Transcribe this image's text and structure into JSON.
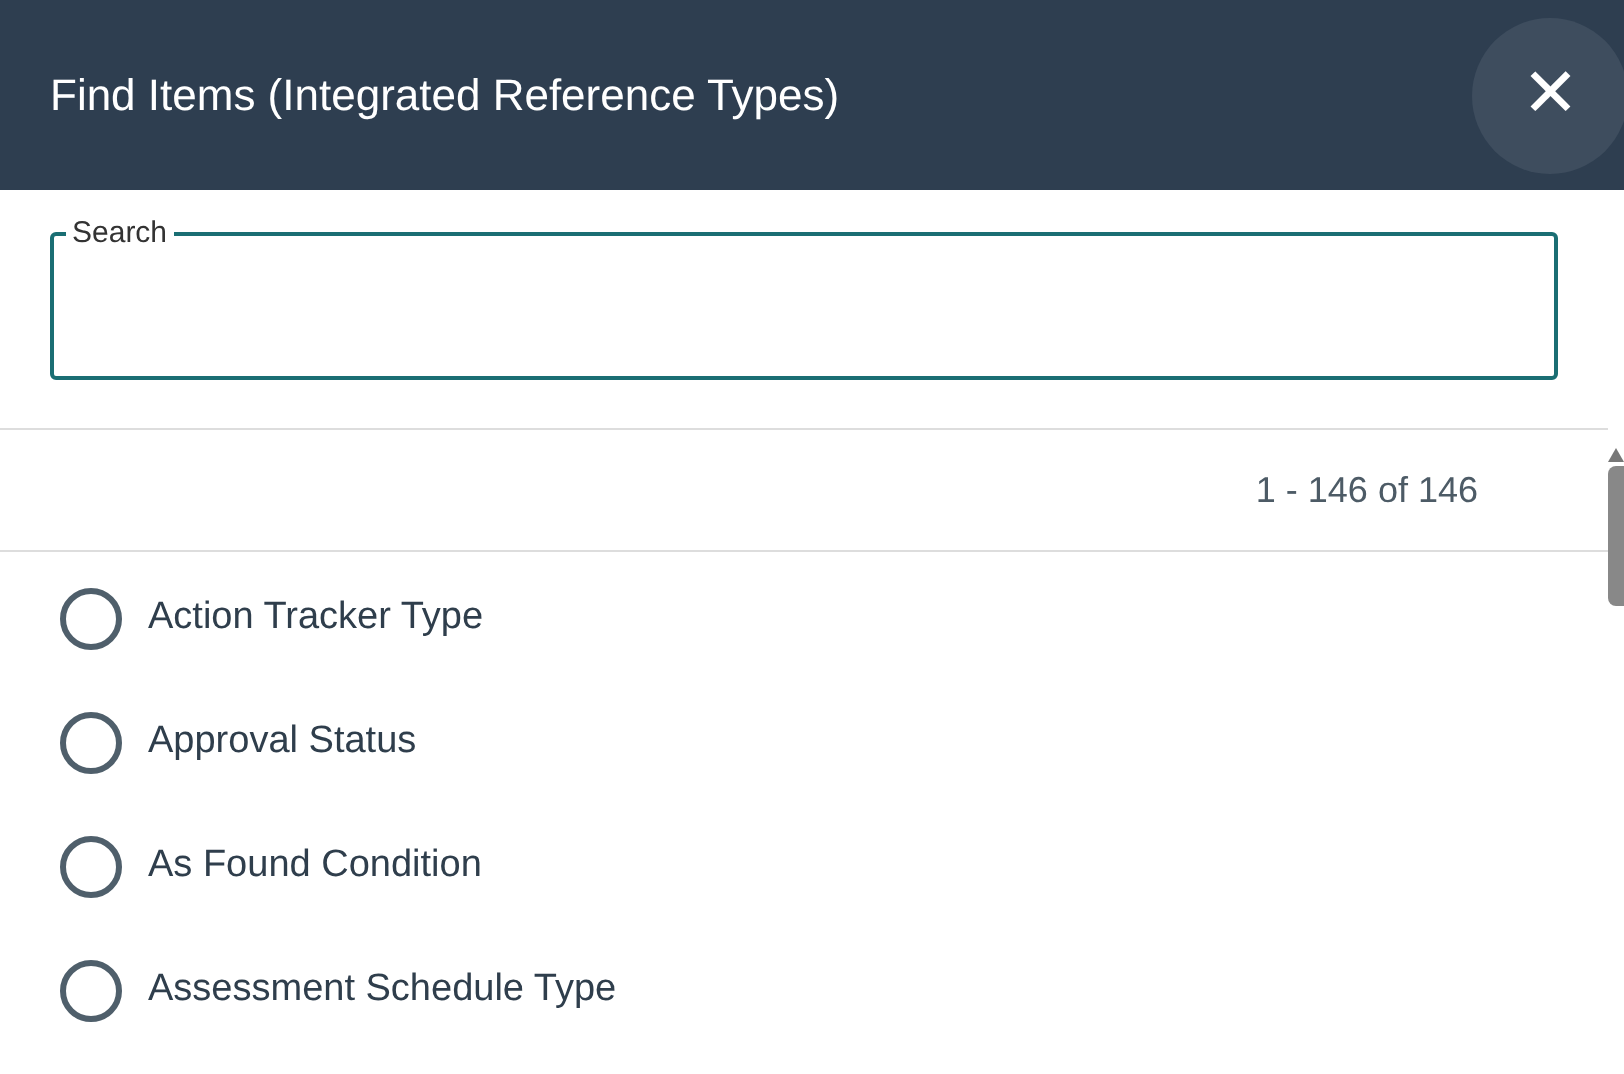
{
  "dialog": {
    "title": "Find Items (Integrated Reference Types)",
    "close": "✕"
  },
  "search": {
    "label": "Search"
  },
  "count": "1 - 146 of 146",
  "items": [
    {
      "label": "Action Tracker Type",
      "selected": false
    },
    {
      "label": "Approval Status",
      "selected": false
    },
    {
      "label": "As Found Condition",
      "selected": false
    },
    {
      "label": "Assessment Schedule Type",
      "selected": false
    }
  ]
}
